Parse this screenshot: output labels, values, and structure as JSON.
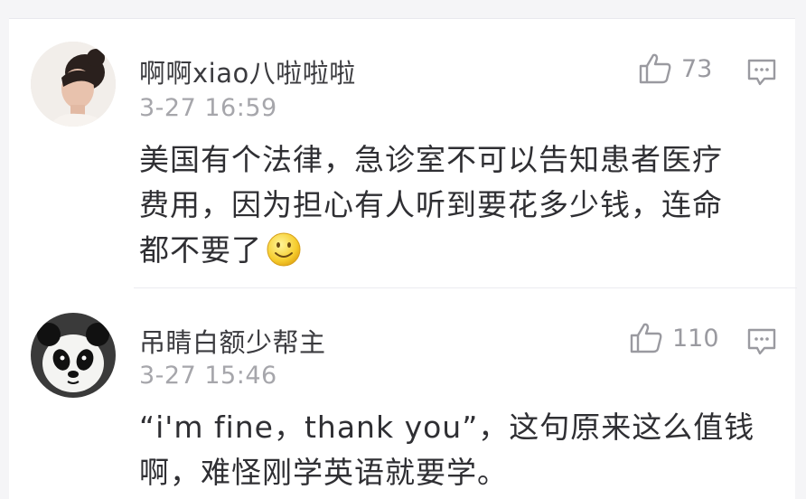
{
  "comments": [
    {
      "username": "啊啊xiao八啦啦啦",
      "timestamp": "3-27 16:59",
      "likes": "73",
      "lines": [
        "美国有个法律，急诊室不可以告知患者医疗",
        "费用，因为担心有人听到要花多少钱，连命",
        "都不要了"
      ],
      "avatar_icon": "user-avatar-woman",
      "like_icon": "thumbs-up-icon",
      "reply_icon": "comment-icon",
      "inline_emoji": "smile-emoji-icon"
    },
    {
      "username": "吊睛白额少帮主",
      "timestamp": "3-27 15:46",
      "likes": "110",
      "lines": [
        "“i'm fine，thank you”，这句原来这么值钱",
        "啊，难怪刚学英语就要学。"
      ],
      "avatar_icon": "user-avatar-panda",
      "like_icon": "thumbs-up-icon",
      "reply_icon": "comment-icon"
    }
  ],
  "colors": {
    "username": "#3b3b3f",
    "timestamp": "#a6a6ab",
    "body": "#2f2f33",
    "icon": "#9a9aa0",
    "background": "#ffffff"
  }
}
